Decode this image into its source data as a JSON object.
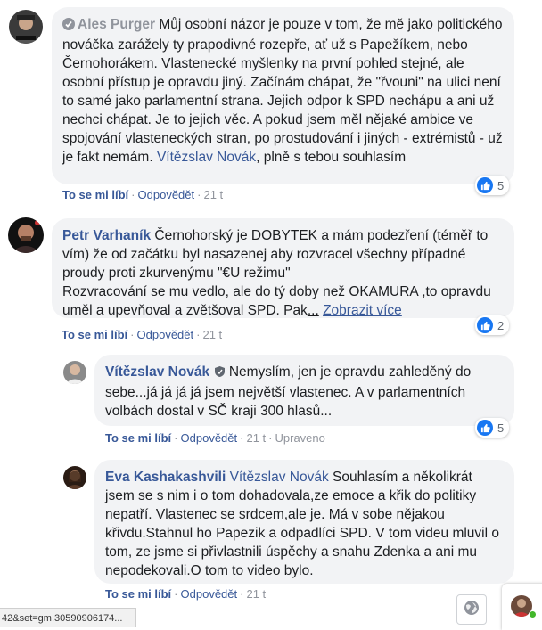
{
  "comments": [
    {
      "author": "Ales Purger",
      "text": "Můj osobní názor je pouze v tom, že mě jako politického nováčka zarážely ty prapodivné rozepře, ať už s Papežíkem, nebo Černohorákem. Vlastenecké myšlenky na první pohled stejné, ale osobní přístup je opravdu jiný. Začínám chápat, že \"řvouni\" na ulici není to samé jako parlamentní strana. Jejich odpor k SPD nechápu a ani už nechci chápat. Je to jejich věc. A pokud jsem měl nějaké ambice ve spojování vlasteneckých stran, po prostudování i jiných - extrémistů - už je fakt nemám.",
      "mention": "Vítězslav Novák",
      "text_after": ", plně s tebou souhlasím",
      "like_label": "To se mi líbí",
      "reply_label": "Odpovědět",
      "time": "21 t",
      "reactions": "5"
    },
    {
      "author": "Petr Varhaník",
      "text": "Černohorský je DOBYTEK a mám podezření (téměř to vím) že od začátku byl nasazenej aby rozvracel všechny případné proudy proti zkurvenýmu \"€U režimu\"\nRozvracování se mu vedlo, ale do tý doby než OKAMURA ,to opravdu uměl a upevňoval a zvětšoval SPD. Pak",
      "ellipsis": "...",
      "see_more": "Zobrazit více",
      "like_label": "To se mi líbí",
      "reply_label": "Odpovědět",
      "time": "21 t",
      "reactions": "2"
    },
    {
      "author": "Vítězslav Novák",
      "text": "Nemyslím, jen je opravdu zahleděný do sebe...já já já já jsem největší vlastenec. A v parlamentních volbách dostal v SČ kraji 300 hlasů...",
      "like_label": "To se mi líbí",
      "reply_label": "Odpovědět",
      "time": "21 t",
      "edited_label": "Upraveno",
      "reactions": "5"
    },
    {
      "author": "Eva Kashakashvili",
      "mention": "Vítězslav Novák",
      "text": "Souhlasím a několikrát jsem se s nim i o tom dohadovala,ze emoce a křik do politiky nepatří. Vlastenec se srdcem,ale je. Má v sobe nějakou křivdu.Stahnul ho Papezik a odpadlíci SPD. V tom videu mluvil o tom, ze jsme si přivlastnili úspěchy a snahu Zdenka a ani mu nepodekovali.O tom to video bylo.",
      "like_label": "To se mi líbí",
      "reply_label": "Odpovědět",
      "time": "21 t"
    }
  ],
  "status_url": "42&set=gm.30590906174...",
  "colors": {
    "link": "#385898",
    "bubble": "#f2f3f5",
    "like": "#1877f2"
  }
}
